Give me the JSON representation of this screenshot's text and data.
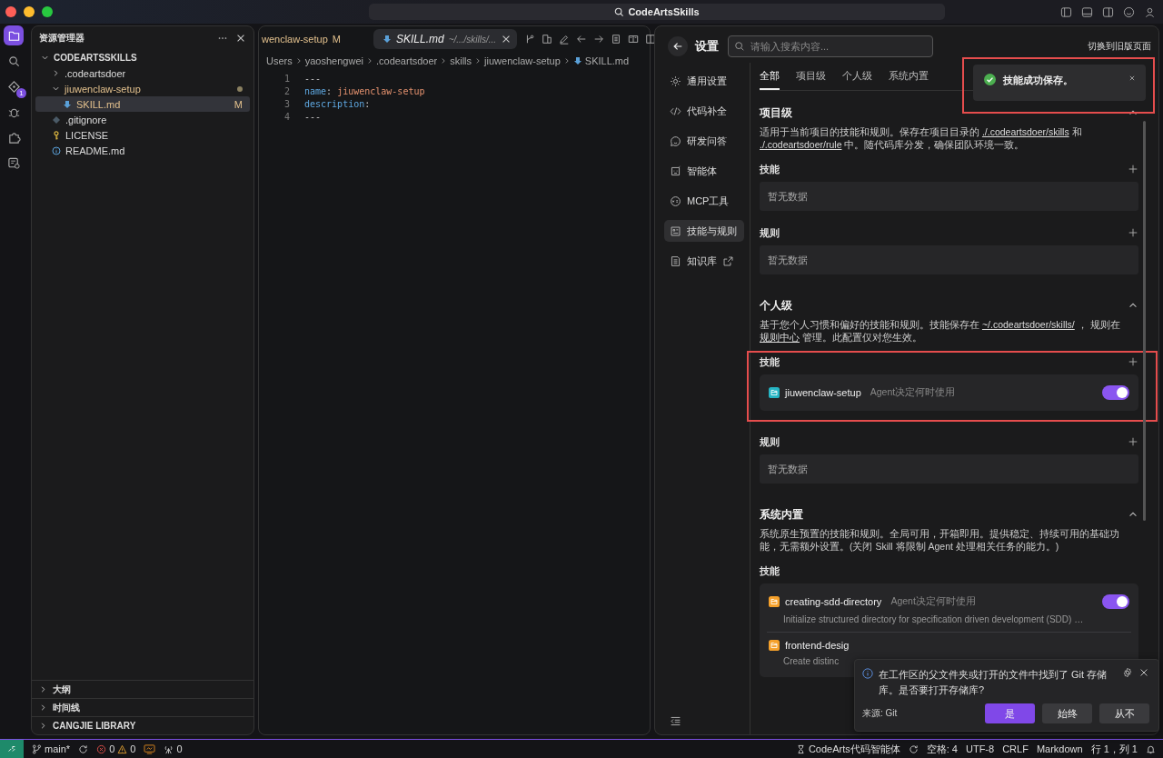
{
  "window": {
    "title": "CodeArtsSkills"
  },
  "activity_bar": {
    "badge": "1"
  },
  "explorer": {
    "title": "资源管理器",
    "tree": [
      {
        "label": "CODEARTSSKILLS",
        "kind": "root",
        "expanded": true,
        "selected": false,
        "modified": false,
        "children": [
          {
            "label": ".codeartsdoer",
            "kind": "folder",
            "expanded": false,
            "selected": false,
            "modified": false
          },
          {
            "label": "jiuwenclaw-setup",
            "kind": "folder",
            "expanded": true,
            "selected": false,
            "modified": true,
            "children": [
              {
                "label": "SKILL.md",
                "kind": "markdown",
                "selected": true,
                "modified": true,
                "status": "M"
              }
            ]
          },
          {
            "label": ".gitignore",
            "kind": "gitignore",
            "selected": false,
            "modified": false
          },
          {
            "label": "LICENSE",
            "kind": "license",
            "selected": false,
            "modified": false
          },
          {
            "label": "README.md",
            "kind": "info",
            "selected": false,
            "modified": false
          }
        ]
      }
    ],
    "sections": [
      {
        "label": "大纲",
        "expanded": false
      },
      {
        "label": "时间线",
        "expanded": false
      },
      {
        "label": "CANGJIE LIBRARY",
        "expanded": false
      }
    ]
  },
  "editor": {
    "tabs": [
      {
        "label": "wenclaw-setup",
        "status": "M",
        "selected": false
      },
      {
        "label": "SKILL.md",
        "path": "~/.../skills/...",
        "selected": true
      }
    ],
    "breadcrumbs": [
      "Users",
      "yaoshengwei",
      ".codeartsdoer",
      "skills",
      "jiuwenclaw-setup",
      "SKILL.md"
    ],
    "lines": [
      {
        "number": "1",
        "tokens": [
          {
            "text": "---",
            "kind": "punct"
          }
        ]
      },
      {
        "number": "2",
        "tokens": [
          {
            "text": "name",
            "kind": "key"
          },
          {
            "text": ": ",
            "kind": "punct"
          },
          {
            "text": "jiuwenclaw-setup",
            "kind": "value"
          }
        ]
      },
      {
        "number": "3",
        "tokens": [
          {
            "text": "description",
            "kind": "key"
          },
          {
            "text": ":",
            "kind": "punct"
          }
        ]
      },
      {
        "number": "4",
        "tokens": [
          {
            "text": "---",
            "kind": "punct"
          }
        ]
      }
    ]
  },
  "settings": {
    "title": "设置",
    "search": {
      "placeholder": "请输入搜索内容..."
    },
    "switch_link": "切换到旧版页面",
    "nav": [
      {
        "label": "通用设置",
        "selected": false,
        "external": false
      },
      {
        "label": "代码补全",
        "selected": false,
        "external": false
      },
      {
        "label": "研发问答",
        "selected": false,
        "external": false
      },
      {
        "label": "智能体",
        "selected": false,
        "external": false
      },
      {
        "label": "MCP工具",
        "selected": false,
        "external": false
      },
      {
        "label": "技能与规则",
        "selected": true,
        "external": false
      },
      {
        "label": "知识库",
        "selected": false,
        "external": true
      }
    ],
    "tabs": [
      {
        "label": "全部",
        "selected": true
      },
      {
        "label": "项目级",
        "selected": false
      },
      {
        "label": "个人级",
        "selected": false
      },
      {
        "label": "系统内置",
        "selected": false
      }
    ],
    "sections": [
      {
        "title": "项目级",
        "expanded": true,
        "description": [
          {
            "text": "适用于当前项目的技能和规则。保存在项目目录的 ",
            "kind": "text"
          },
          {
            "text": "./.codeartsdoer/skills",
            "kind": "link"
          },
          {
            "text": " 和 ",
            "kind": "text"
          },
          {
            "text": "./.codeartsdoer/rule",
            "kind": "link"
          },
          {
            "text": " 中。随代码库分发，确保团队环境一致。",
            "kind": "text"
          }
        ],
        "groups": [
          {
            "label": "技能",
            "addable": true,
            "empty_text": "暂无数据"
          },
          {
            "label": "规则",
            "addable": true,
            "empty_text": "暂无数据"
          }
        ]
      },
      {
        "title": "个人级",
        "expanded": true,
        "description": [
          {
            "text": "基于您个人习惯和偏好的技能和规则。技能保存在 ",
            "kind": "text"
          },
          {
            "text": "~/.codeartsdoer/skills/",
            "kind": "link"
          },
          {
            "text": " ，  规则在 ",
            "kind": "text"
          },
          {
            "text": "规则中心",
            "kind": "link"
          },
          {
            "text": " 管理。此配置仅对您生效。",
            "kind": "text"
          }
        ],
        "groups": [
          {
            "label": "技能",
            "addable": true,
            "highlighted": true,
            "items": [
              {
                "name": "jiuwenclaw-setup",
                "mode": "Agent决定何时使用",
                "color": "#26b5c4",
                "on": true
              }
            ]
          },
          {
            "label": "规则",
            "addable": true,
            "empty_text": "暂无数据"
          }
        ]
      },
      {
        "title": "系统内置",
        "expanded": true,
        "description": [
          {
            "text": "系统原生预置的技能和规则。全局可用，开箱即用。提供稳定、持续可用的基础功能，无需额外设置。(关闭 Skill 将限制 Agent 处理相关任务的能力。)",
            "kind": "text"
          }
        ],
        "groups": [
          {
            "label": "技能",
            "addable": false,
            "items": [
              {
                "name": "creating-sdd-directory",
                "mode": "Agent决定何时使用",
                "description": "Initialize structured directory for specification driven development (SDD) …",
                "color": "#f5a02a",
                "on": true
              },
              {
                "name": "frontend-desig",
                "description": "Create distinc",
                "color": "#f5a02a"
              }
            ]
          }
        ]
      }
    ]
  },
  "toast": {
    "message": "技能成功保存。",
    "highlighted": true
  },
  "notification": {
    "message": "在工作区的父文件夹或打开的文件中找到了 Git 存储库。是否要打开存储库?",
    "source": "来源: Git",
    "buttons": [
      {
        "label": "是",
        "primary": true
      },
      {
        "label": "始终",
        "primary": false
      },
      {
        "label": "从不",
        "primary": false
      }
    ]
  },
  "status_bar": {
    "branch": "main*",
    "errors": "0",
    "warnings": "0",
    "ports": "0",
    "right": [
      "CodeArts代码智能体",
      "空格: 4",
      "UTF-8",
      "CRLF",
      "Markdown",
      "行 1，列 1"
    ]
  }
}
